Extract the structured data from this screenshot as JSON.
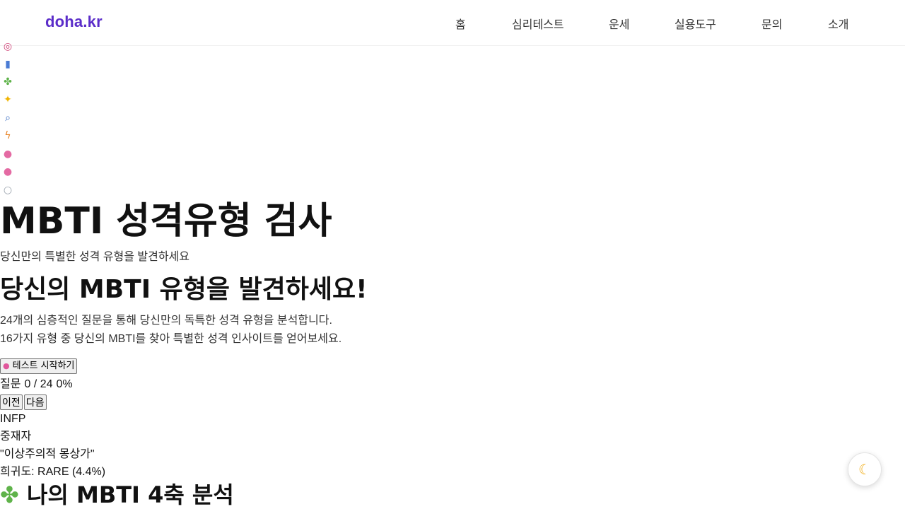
{
  "header": {
    "logo": "doha.kr",
    "nav": [
      "홈",
      "심리테스트",
      "운세",
      "실용도구",
      "문의",
      "소개"
    ]
  },
  "side_emojis": [
    {
      "icon": "target-icon",
      "glyph": "◎"
    },
    {
      "icon": "bar-chart-icon",
      "glyph": "▮"
    },
    {
      "icon": "puzzle-icon",
      "glyph": "✤"
    },
    {
      "icon": "lightbulb-icon",
      "glyph": "✦"
    },
    {
      "icon": "magnifier-icon",
      "glyph": "⌕"
    },
    {
      "icon": "lightning-icon",
      "glyph": "ϟ"
    },
    {
      "icon": "brain-icon",
      "glyph": "●"
    },
    {
      "icon": "brain-icon",
      "glyph": "●"
    },
    {
      "icon": "thought-bubble-icon",
      "glyph": "○"
    }
  ],
  "hero": {
    "title": "MBTI 성격유형 검사",
    "subtitle": "당신만의 특별한 성격 유형을 발견하세요"
  },
  "intro": {
    "heading": "당신의 MBTI 유형을 발견하세요!",
    "desc_line1": "24개의 심층적인 질문을 통해 당신만의 독특한 성격 유형을 분석합니다.",
    "desc_line2": "16가지 유형 중 당신의 MBTI를 찾아 특별한 성격 인사이트를 얻어보세요.",
    "start_label": "테스트 시작하기",
    "start_icon": "brain-icon"
  },
  "progress": {
    "label": "질문",
    "current_total": "0 / 24",
    "percent": "0%",
    "value": 0
  },
  "buttons": {
    "prev": "이전",
    "next": "다음"
  },
  "result": {
    "type": "INFP",
    "name": "중재자",
    "quote": "\"이상주의적 몽상가\"",
    "rarity": "희귀도: RARE (4.4%)",
    "analysis_heading": "나의 MBTI 4축 분석",
    "analysis_icon": "puzzle-icon"
  },
  "theme_toggle": {
    "icon": "moon-icon",
    "glyph": "☾"
  }
}
